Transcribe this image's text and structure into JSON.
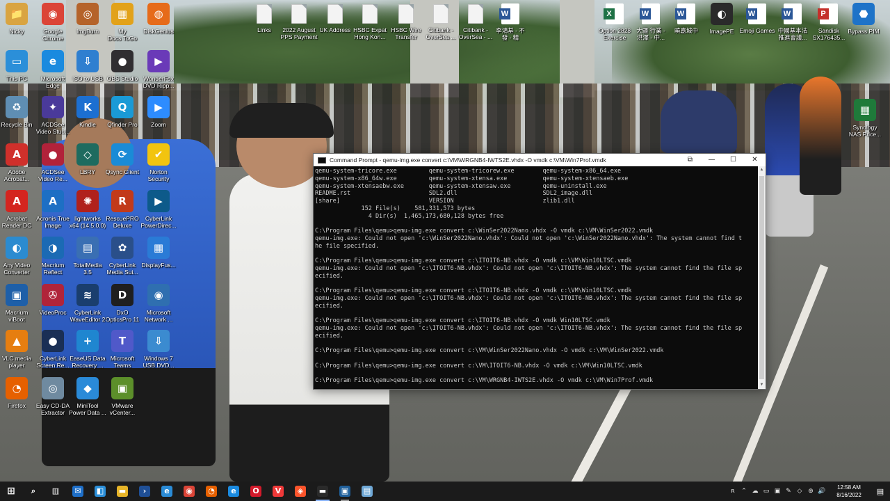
{
  "desktop": {
    "icons": [
      {
        "label": "Nicky",
        "glyph": "📁",
        "color": "#d9a441",
        "icon": "user-folder-icon"
      },
      {
        "label": "Google\nChrome",
        "glyph": "◉",
        "color": "#db4437",
        "icon": "chrome-icon"
      },
      {
        "label": "ImgBurn",
        "glyph": "◎",
        "color": "#b5632a",
        "icon": "imgburn-icon"
      },
      {
        "label": "My\nDocs ToGo",
        "glyph": "▦",
        "color": "#e2a21a",
        "icon": "docs-to-go-icon"
      },
      {
        "label": "DiskGenius",
        "glyph": "◍",
        "color": "#e66b1a",
        "icon": "diskgenius-icon"
      },
      {
        "label": "This PC",
        "glyph": "▭",
        "color": "#2b8fd9",
        "icon": "this-pc-icon"
      },
      {
        "label": "Microsoft\nEdge",
        "glyph": "e",
        "color": "#1a8adf",
        "icon": "edge-icon"
      },
      {
        "label": "ISO to USB",
        "glyph": "⇩",
        "color": "#2f7fd0",
        "icon": "iso-to-usb-icon"
      },
      {
        "label": "OBS Studio",
        "glyph": "●",
        "color": "#302e31",
        "icon": "obs-icon"
      },
      {
        "label": "WonderFox\nDVD Ripp...",
        "glyph": "▶",
        "color": "#6a3ab8",
        "icon": "wonderfox-icon"
      },
      {
        "label": "Recycle Bin",
        "glyph": "♻",
        "color": "#5f8eb3",
        "icon": "recycle-bin-icon"
      },
      {
        "label": "ACDSee\nVideo Stud...",
        "glyph": "✦",
        "color": "#4a3a9a",
        "icon": "acdsee-studio-icon"
      },
      {
        "label": "Kindle",
        "glyph": "K",
        "color": "#1c6fd1",
        "icon": "kindle-icon"
      },
      {
        "label": "Qfinder Pro",
        "glyph": "Q",
        "color": "#1a9ad6",
        "icon": "qfinder-icon"
      },
      {
        "label": "Zoom",
        "glyph": "▶",
        "color": "#2d8cff",
        "icon": "zoom-icon"
      },
      {
        "label": "Adobe\nAcrobat...",
        "glyph": "A",
        "color": "#d0302b",
        "icon": "acrobat-icon"
      },
      {
        "label": "ACDSee\nVideo Re...",
        "glyph": "●",
        "color": "#b2223a",
        "icon": "acdsee-recorder-icon"
      },
      {
        "label": "LBRY",
        "glyph": "◇",
        "color": "#1e6b5f",
        "icon": "lbry-icon"
      },
      {
        "label": "Qsync Client",
        "glyph": "⟳",
        "color": "#1a8bd6",
        "icon": "qsync-icon"
      },
      {
        "label": "Norton\nSecurity",
        "glyph": "✔",
        "color": "#f2c40f",
        "icon": "norton-icon"
      },
      {
        "label": "Acrobat\nReader DC",
        "glyph": "A",
        "color": "#d4251f",
        "icon": "reader-icon"
      },
      {
        "label": "Acronis True\nImage",
        "glyph": "A",
        "color": "#1d6fc4",
        "icon": "acronis-icon"
      },
      {
        "label": "lightworks\nx64 (14.5.0.0)",
        "glyph": "✺",
        "color": "#b0211c",
        "icon": "lightworks-icon"
      },
      {
        "label": "RescuePRO\nDeluxe",
        "glyph": "R",
        "color": "#c23a1a",
        "icon": "rescuepro-icon"
      },
      {
        "label": "CyberLink\nPowerDirec...",
        "glyph": "▶",
        "color": "#0d5a8a",
        "icon": "powerdirector-icon"
      },
      {
        "label": "Any Video\nConverter",
        "glyph": "◐",
        "color": "#2b8bd0",
        "icon": "any-video-converter-icon"
      },
      {
        "label": "Macrium\nReflect",
        "glyph": "◑",
        "color": "#1b6ab4",
        "icon": "macrium-icon"
      },
      {
        "label": "TotalMedia\n3.5",
        "glyph": "▤",
        "color": "#3a6fb3",
        "icon": "totalmedia-icon"
      },
      {
        "label": "CyberLink\nMedia Sui...",
        "glyph": "✿",
        "color": "#2a4f8a",
        "icon": "media-suite-icon"
      },
      {
        "label": "DisplayFus...",
        "glyph": "▦",
        "color": "#2a7bd6",
        "icon": "displayfusion-icon"
      },
      {
        "label": "Macrium\nviBoot",
        "glyph": "▣",
        "color": "#1e5fa8",
        "icon": "viboot-icon"
      },
      {
        "label": "VideoProc",
        "glyph": "✇",
        "color": "#b0243a",
        "icon": "videoproc-icon"
      },
      {
        "label": "CyberLink\nWaveEditor 2",
        "glyph": "≋",
        "color": "#1a3e6e",
        "icon": "waveeditor-icon"
      },
      {
        "label": "DxO\nOpticsPro 11",
        "glyph": "D",
        "color": "#1f1f1f",
        "icon": "dxo-icon"
      },
      {
        "label": "Microsoft\nNetwork ...",
        "glyph": "◉",
        "color": "#2f6fb0",
        "icon": "network-monitor-icon"
      },
      {
        "label": "VLC media\nplayer",
        "glyph": "▲",
        "color": "#e67e10",
        "icon": "vlc-icon"
      },
      {
        "label": "CyberLink\nScreen Re...",
        "glyph": "●",
        "color": "#1a2f55",
        "icon": "screen-recorder-icon"
      },
      {
        "label": "EaseUS Data\nRecovery ...",
        "glyph": "+",
        "color": "#1f86d0",
        "icon": "easeus-icon"
      },
      {
        "label": "Microsoft\nTeams",
        "glyph": "T",
        "color": "#5059c9",
        "icon": "teams-icon"
      },
      {
        "label": "Windows 7\nUSB DVD...",
        "glyph": "⇩",
        "color": "#3b8bd0",
        "icon": "win7-usb-icon"
      },
      {
        "label": "Firefox",
        "glyph": "◔",
        "color": "#e66000",
        "icon": "firefox-icon"
      },
      {
        "label": "Easy CD-DA\nExtractor",
        "glyph": "◎",
        "color": "#6f8aa0",
        "icon": "cd-extractor-icon"
      },
      {
        "label": "MiniTool\nPower Data ...",
        "glyph": "◆",
        "color": "#2a8ad8",
        "icon": "minitool-icon"
      },
      {
        "label": "VMware\nvCenter...",
        "glyph": "▣",
        "color": "#5c8f2a",
        "icon": "vmware-icon"
      }
    ],
    "top_icons": [
      {
        "label": "Links",
        "kind": "file"
      },
      {
        "label": "2022 August\nPPS Payment",
        "kind": "file"
      },
      {
        "label": "UK Address",
        "kind": "file"
      },
      {
        "label": "HSBC Expat\nHong Kon...",
        "kind": "file"
      },
      {
        "label": "HSBC Wire\nTransfer",
        "kind": "file"
      },
      {
        "label": "Citibank -\nOverSea ...",
        "kind": "file"
      },
      {
        "label": "Citibank -\nOverSea - ...",
        "kind": "file"
      },
      {
        "label": "李鴻基 - 不\n發 - 精",
        "kind": "word"
      },
      {
        "label": "Option 2828\nExercise",
        "kind": "excel"
      },
      {
        "label": "大疆 行業 -\n洪澤 - 中...",
        "kind": "word"
      },
      {
        "label": "曉嘉城中",
        "kind": "word"
      },
      {
        "label": "ImagePE",
        "kind": "app"
      },
      {
        "label": "Emoji Games",
        "kind": "word"
      },
      {
        "label": "中國基本法\n推進會議...",
        "kind": "word"
      },
      {
        "label": "Sandisk\nSX176435...",
        "kind": "pdf"
      },
      {
        "label": "Bypass PIM",
        "kind": "app2"
      }
    ],
    "right_icon": {
      "label": "Synology\nNAS Price...",
      "glyph": "▦",
      "color": "#1f7a3a"
    }
  },
  "cmd": {
    "title": "Command Prompt - qemu-img.exe  convert c:\\VM\\WRGNB4-IWTS2E.vhdx -O vmdk c:\\VM\\Win7Prof.vmdk",
    "lines": [
      "qemu-system-tricore.exe         qemu-system-tricorew.exe        qemu-system-x86_64.exe",
      "qemu-system-x86_64w.exe         qemu-system-xtensa.exe          qemu-system-xtensaeb.exe",
      "qemu-system-xtensaebw.exe       qemu-system-xtensaw.exe         qemu-uninstall.exe",
      "README.rst                      SDL2.dll                        SDL2_image.dll",
      "[share]                         VERSION                         zlib1.dll",
      "             152 File(s)    581,331,573 bytes",
      "               4 Dir(s)  1,465,173,680,128 bytes free",
      "",
      "C:\\Program Files\\qemu>qemu-img.exe convert c:\\WinSer2022Nano.vhdx -O vmdk c:\\VM\\WinSer2022.vmdk",
      "qemu-img.exe: Could not open 'c:\\WinSer2022Nano.vhdx': Could not open 'c:\\WinSer2022Nano.vhdx': The system cannot find t",
      "he file specified.",
      "",
      "C:\\Program Files\\qemu>qemu-img.exe convert c:\\ITOIT6-NB.vhdx -O vmdk c:\\VM\\Win10LTSC.vmdk",
      "qemu-img.exe: Could not open 'c:\\ITOIT6-NB.vhdx': Could not open 'c:\\ITOIT6-NB.vhdx': The system cannot find the file sp",
      "ecified.",
      "",
      "C:\\Program Files\\qemu>qemu-img.exe convert c:\\ITOIT6-NB.vhdx -O vmdk c:\\VM\\Win10LTSC.vmdk",
      "qemu-img.exe: Could not open 'c:\\ITOIT6-NB.vhdx': Could not open 'c:\\ITOIT6-NB.vhdx': The system cannot find the file sp",
      "ecified.",
      "",
      "C:\\Program Files\\qemu>qemu-img.exe convert c:\\ITOIT6-NB.vhdx -O vmdk Win10LTSC.vmdk",
      "qemu-img.exe: Could not open 'c:\\ITOIT6-NB.vhdx': Could not open 'c:\\ITOIT6-NB.vhdx': The system cannot find the file sp",
      "ecified.",
      "",
      "C:\\Program Files\\qemu>qemu-img.exe convert c:\\VM\\WinSer2022Nano.vhdx -O vmdk c:\\VM\\WinSer2022.vmdk",
      "",
      "C:\\Program Files\\qemu>qemu-img.exe convert c:\\VM\\ITOIT6-NB.vhdx -O vmdk c:\\VM\\Win10LTSC.vmdk",
      "",
      "C:\\Program Files\\qemu>qemu-img.exe convert c:\\VM\\WRGNB4-IWTS2E.vhdx -O vmdk c:\\VM\\Win7Prof.vmdk"
    ],
    "controls": {
      "restore": "⧉",
      "minimize": "—",
      "maximize": "☐",
      "close": "✕"
    }
  },
  "taskbar": {
    "start_glyph": "⊞",
    "items": [
      {
        "name": "search",
        "glyph": "⌕",
        "color": "transparent",
        "state": ""
      },
      {
        "name": "task-view",
        "glyph": "▥",
        "color": "transparent",
        "state": ""
      },
      {
        "name": "mail",
        "glyph": "✉",
        "color": "#1e6fc8",
        "state": ""
      },
      {
        "name": "store",
        "glyph": "◧",
        "color": "#2b8fd9",
        "state": ""
      },
      {
        "name": "file-explorer",
        "glyph": "▬",
        "color": "#e6b428",
        "state": ""
      },
      {
        "name": "powershell",
        "glyph": "›",
        "color": "#1f4f96",
        "state": ""
      },
      {
        "name": "internet-explorer",
        "glyph": "e",
        "color": "#2a8bd6",
        "state": ""
      },
      {
        "name": "chrome",
        "glyph": "◉",
        "color": "#db4437",
        "state": ""
      },
      {
        "name": "firefox",
        "glyph": "◔",
        "color": "#e66000",
        "state": ""
      },
      {
        "name": "edge",
        "glyph": "e",
        "color": "#1a8adf",
        "state": ""
      },
      {
        "name": "opera",
        "glyph": "O",
        "color": "#d21a2b",
        "state": ""
      },
      {
        "name": "vivaldi",
        "glyph": "V",
        "color": "#ef3939",
        "state": ""
      },
      {
        "name": "brave",
        "glyph": "◈",
        "color": "#fb542b",
        "state": ""
      },
      {
        "name": "command-prompt",
        "glyph": "▬",
        "color": "#2a2a2a",
        "state": "active"
      },
      {
        "name": "remote-desktop",
        "glyph": "▣",
        "color": "#1f5f9a",
        "state": "open"
      },
      {
        "name": "notepad",
        "glyph": "▤",
        "color": "#6fa8d6",
        "state": ""
      }
    ],
    "tray": {
      "glyphs": [
        "ʀ",
        "⌃",
        "☁",
        "▭",
        "▣",
        "✎",
        "◇",
        "⊕",
        "🔊"
      ],
      "time": "12:58 AM",
      "date": "8/16/2022",
      "notif": "▤"
    }
  }
}
